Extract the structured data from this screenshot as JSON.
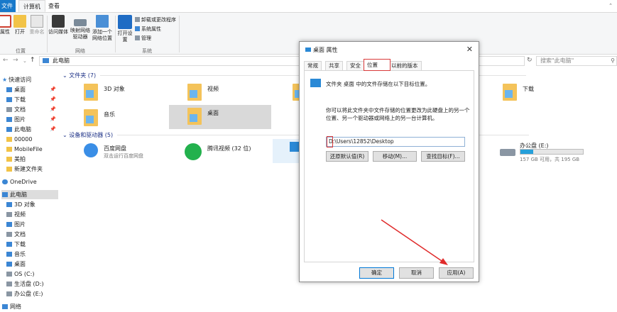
{
  "ribbon": {
    "tabs": [
      "文件",
      "计算机",
      "查看"
    ],
    "buttons": {
      "properties": "属性",
      "open": "打开",
      "rename": "重命名",
      "access_media": "访问媒体",
      "map_drive": "映射网络驱动器",
      "add_location": "添加一个网络位置",
      "open_settings": "打开设置"
    },
    "system_cmds": [
      "卸载或更改程序",
      "系统属性",
      "管理"
    ],
    "groups": [
      "位置",
      "网络",
      "系统"
    ]
  },
  "address": {
    "path": "此电脑",
    "search_placeholder": "搜索\"此电脑\""
  },
  "sidebar": {
    "items": [
      {
        "label": "快速访问",
        "icon": "star-icon"
      },
      {
        "label": "桌面",
        "icon": "desktop-icon",
        "pinned": true
      },
      {
        "label": "下载",
        "icon": "download-icon",
        "pinned": true
      },
      {
        "label": "文档",
        "icon": "document-icon",
        "pinned": true
      },
      {
        "label": "图片",
        "icon": "picture-icon",
        "pinned": true
      },
      {
        "label": "此电脑",
        "icon": "pc-icon",
        "pinned": true
      },
      {
        "label": "00000",
        "icon": "folder-icon"
      },
      {
        "label": "MobileFile",
        "icon": "folder-icon"
      },
      {
        "label": "美拍",
        "icon": "folder-icon"
      },
      {
        "label": "新建文件夹",
        "icon": "folder-icon"
      },
      {
        "label": "OneDrive",
        "icon": "cloud-icon"
      },
      {
        "label": "此电脑",
        "icon": "pc-icon",
        "selected": true
      },
      {
        "label": "3D 对象",
        "icon": "cube-icon"
      },
      {
        "label": "视频",
        "icon": "video-icon"
      },
      {
        "label": "图片",
        "icon": "picture-icon"
      },
      {
        "label": "文档",
        "icon": "document-icon"
      },
      {
        "label": "下载",
        "icon": "download-icon"
      },
      {
        "label": "音乐",
        "icon": "music-icon"
      },
      {
        "label": "桌面",
        "icon": "desktop-icon"
      },
      {
        "label": "OS (C:)",
        "icon": "drive-icon"
      },
      {
        "label": "生活盘 (D:)",
        "icon": "drive-icon"
      },
      {
        "label": "办公盘 (E:)",
        "icon": "drive-icon"
      },
      {
        "label": "网络",
        "icon": "network-icon"
      }
    ]
  },
  "main": {
    "folders_header": "文件夹 (7)",
    "devices_header": "设备和驱动器 (5)",
    "folders": [
      {
        "name": "3D 对象"
      },
      {
        "name": "视频"
      },
      {
        "name": "下载"
      },
      {
        "name": "音乐"
      },
      {
        "name": "桌面",
        "selected": true
      }
    ],
    "devices": [
      {
        "name": "百度网盘",
        "sub": "双击运行百度网盘"
      },
      {
        "name": "腾讯视频 (32 位)",
        "sub": ""
      },
      {
        "name": "办公盘 (E:)",
        "sub": "157 GB 可用，共 195 GB",
        "used_fraction": 0.2
      }
    ]
  },
  "dialog": {
    "title": "桌面 属性",
    "tabs": [
      "常规",
      "共享",
      "安全",
      "位置",
      "以前的版本"
    ],
    "active_tab": "位置",
    "target_text": "文件夹 桌面 中的文件存储在以下目标位置。",
    "description": "你可以将此文件夹中文件存储的位置更改为此硬盘上的另一个位置、另一个驱动器或网络上的另一台计算机。",
    "path_value": "D:\\Users\\12852\\Desktop",
    "buttons": {
      "restore": "还原默认值(R)",
      "move": "移动(M)...",
      "find": "查找目标(F)...",
      "ok": "确定",
      "cancel": "取消",
      "apply": "应用(A)"
    }
  },
  "colors": {
    "accent": "#1979ca",
    "highlight": "#d93a3a",
    "drive_bar": "#26a0da"
  }
}
